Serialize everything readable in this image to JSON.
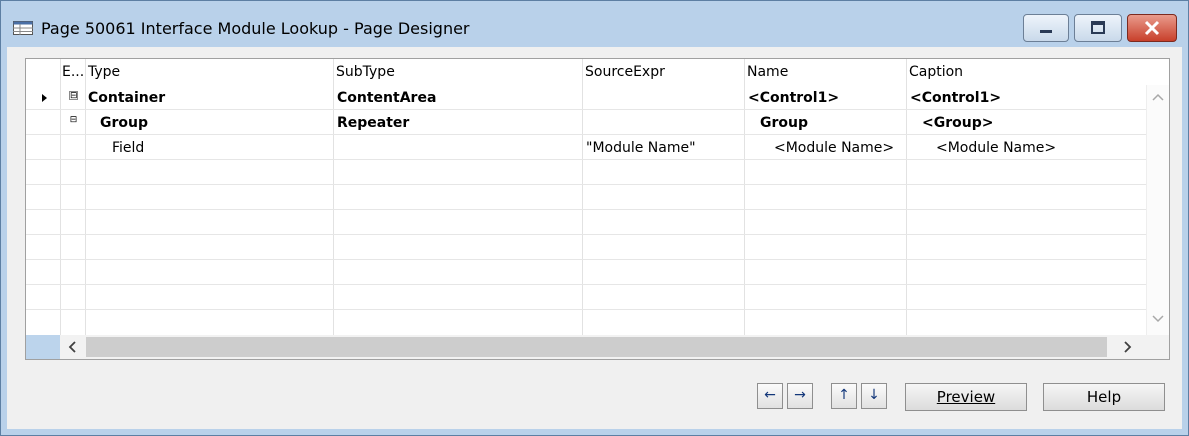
{
  "window": {
    "title": "Page 50061 Interface Module Lookup - Page Designer",
    "icons": {
      "app": "table-icon",
      "minimize": "minimize-icon",
      "maximize": "maximize-icon",
      "close": "close-icon"
    }
  },
  "grid": {
    "columns": [
      "E...",
      "Type",
      "SubType",
      "SourceExpr",
      "Name",
      "Caption"
    ],
    "rows": [
      {
        "type": "Container",
        "subtype": "ContentArea",
        "source": "",
        "name": "<Control1>",
        "caption": "<Control1>"
      },
      {
        "type": "Group",
        "subtype": "Repeater",
        "source": "",
        "name": "Group",
        "caption": "<Group>"
      },
      {
        "type": "Field",
        "subtype": "",
        "source": "\"Module Name\"",
        "name": "<Module Name>",
        "caption": "<Module Name>"
      }
    ],
    "expander_symbol": "⊟",
    "scroll_left": "<",
    "scroll_right": ">",
    "scroll_up": "^",
    "scroll_down": "v"
  },
  "buttons": {
    "move_left": "←",
    "move_right": "→",
    "move_up": "↑",
    "move_down": "↓",
    "preview_label": "Preview",
    "help_label": "Help"
  }
}
